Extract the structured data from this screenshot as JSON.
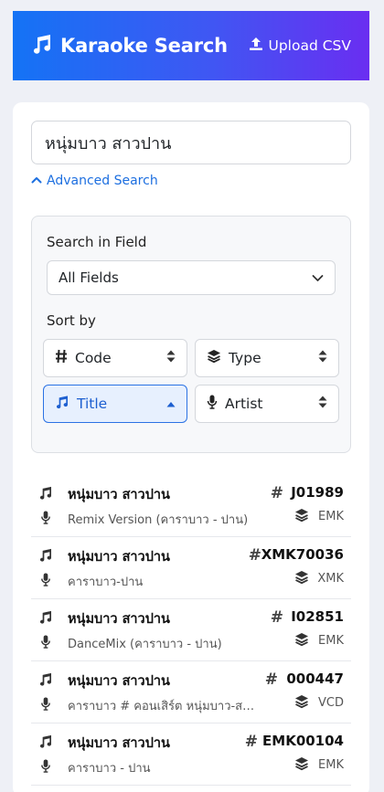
{
  "header": {
    "title": "Karaoke Search",
    "upload_label": "Upload CSV"
  },
  "search": {
    "value": "หนุ่มบาว สาวปาน"
  },
  "advanced": {
    "toggle_label": "Advanced Search",
    "field_label": "Search in Field",
    "field_value": "All Fields",
    "sort_label": "Sort by",
    "sort_options": [
      {
        "label": "Code"
      },
      {
        "label": "Type"
      },
      {
        "label": "Title"
      },
      {
        "label": "Artist"
      }
    ],
    "active_sort": "Title"
  },
  "results": [
    {
      "title": "หนุ่มบาว สาวปาน",
      "artist": "Remix Version (คาราบาว - ปาน)",
      "code": "J01989",
      "type": "EMK"
    },
    {
      "title": "หนุ่มบาว สาวปาน",
      "artist": "คาราบาว-ปาน",
      "code": "XMK70036",
      "type": "XMK"
    },
    {
      "title": "หนุ่มบาว สาวปาน",
      "artist": "DanceMix (คาราบาว - ปาน)",
      "code": "I02851",
      "type": "EMK"
    },
    {
      "title": "หนุ่มบาว สาวปาน",
      "artist": "คาราบาว # คอนเสิร์ต หนุ่มบาว-สาวปาน",
      "code": "000447",
      "type": "VCD"
    },
    {
      "title": "หนุ่มบาว สาวปาน",
      "artist": "คาราบาว - ปาน",
      "code": "EMK00104",
      "type": "EMK"
    }
  ]
}
